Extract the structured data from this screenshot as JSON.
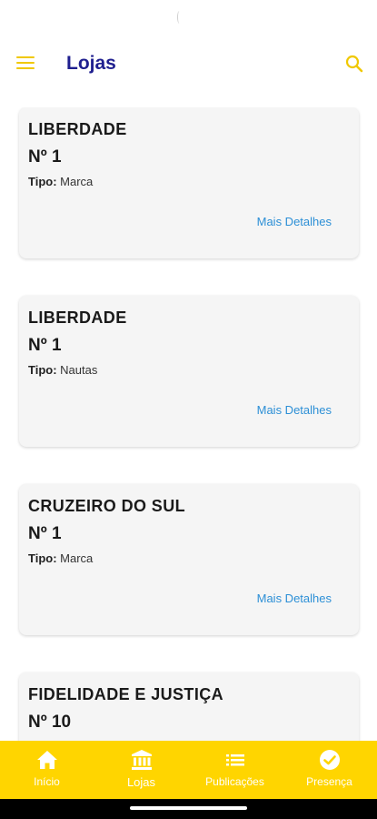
{
  "app_bar": {
    "title": "Lojas"
  },
  "cards": [
    {
      "name": "LIBERDADE",
      "number": "Nº 1",
      "type_label": "Tipo:",
      "type_value": "Marca",
      "link": "Mais Detalhes"
    },
    {
      "name": "LIBERDADE",
      "number": "Nº 1",
      "type_label": "Tipo:",
      "type_value": "Nautas",
      "link": "Mais Detalhes"
    },
    {
      "name": "CRUZEIRO DO SUL",
      "number": "Nº 1",
      "type_label": "Tipo:",
      "type_value": "Marca",
      "link": "Mais Detalhes"
    },
    {
      "name": "FIDELIDADE E JUSTIÇA",
      "number": "Nº 10",
      "type_label": "",
      "type_value": "",
      "link": ""
    }
  ],
  "bottom_nav": {
    "items": [
      {
        "label": "Início",
        "icon": "home-icon"
      },
      {
        "label": "Lojas",
        "icon": "bank-icon",
        "active": true
      },
      {
        "label": "Publicações",
        "icon": "list-icon"
      },
      {
        "label": "Presença",
        "icon": "check-circle-icon"
      }
    ]
  },
  "colors": {
    "accent": "#ffd500",
    "title": "#1f1f8f",
    "link": "#2c8fd6"
  }
}
